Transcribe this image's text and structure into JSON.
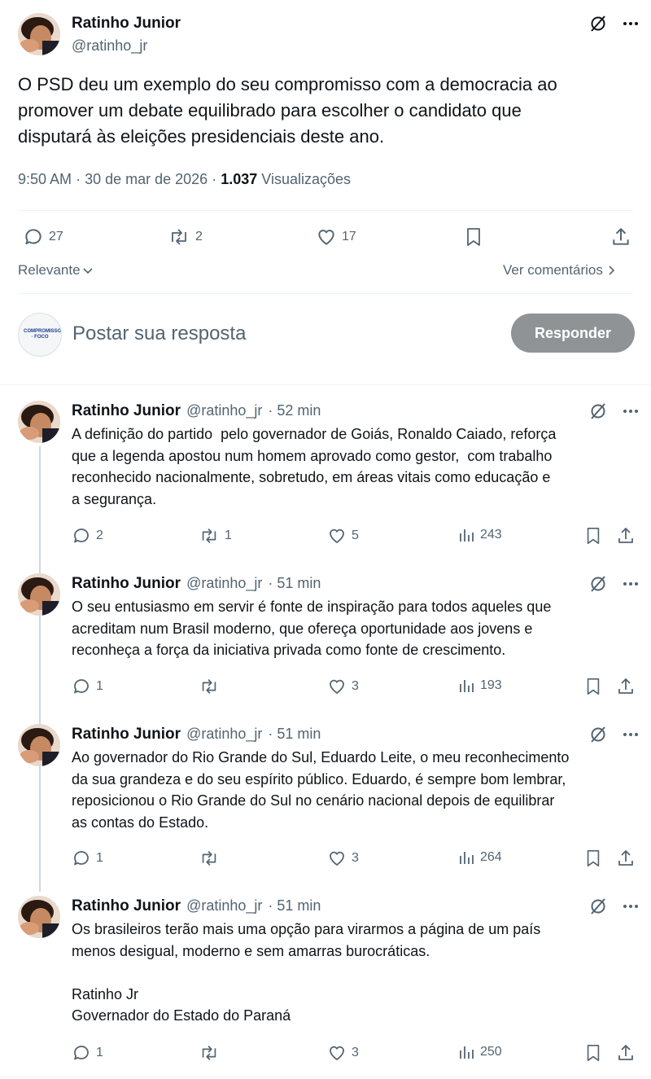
{
  "main_tweet": {
    "author_name": "Ratinho Junior",
    "author_handle": "@ratinho_jr",
    "text": "O PSD deu um exemplo do seu compromisso com a democracia ao\npromover um debate equilibrado para escolher o candidato que\ndisputará às eleições presidenciais deste ano.",
    "time": "9:50 AM",
    "date": "30 de mar de 2026",
    "separator": "·",
    "views_count": "1.037",
    "views_label": "Visualizações",
    "replies": "27",
    "retweets": "2",
    "likes": "17"
  },
  "sort": {
    "label": "Relevante",
    "view_comments": "Ver comentários"
  },
  "compose": {
    "avatar_text": "COMPROMISSO · FOCO",
    "placeholder": "Postar sua resposta",
    "button": "Responder"
  },
  "replies": [
    {
      "name": "Ratinho Junior",
      "handle": "@ratinho_jr",
      "time": "· 52 min",
      "text": "A definição do partido  pelo governador de Goiás, Ronaldo Caiado, reforça\nque a legenda apostou num homem aprovado como gestor,  com trabalho\nreconhecido nacionalmente, sobretudo, em áreas vitais como educação e\na segurança.",
      "replies": "2",
      "retweets": "1",
      "likes": "5",
      "views": "243"
    },
    {
      "name": "Ratinho Junior",
      "handle": "@ratinho_jr",
      "time": "· 51 min",
      "text": "O seu entusiasmo em servir é fonte de inspiração para todos aqueles que\nacreditam num Brasil moderno, que ofereça oportunidade aos jovens e\nreconheça a força da iniciativa privada como fonte de crescimento.",
      "replies": "1",
      "retweets": "",
      "likes": "3",
      "views": "193"
    },
    {
      "name": "Ratinho Junior",
      "handle": "@ratinho_jr",
      "time": "· 51 min",
      "text": "Ao governador do Rio Grande do Sul, Eduardo Leite, o meu reconhecimento\nda sua grandeza e do seu espírito público. Eduardo, é sempre bom lembrar,\nreposicionou o Rio Grande do Sul no cenário nacional depois de equilibrar\nas contas do Estado.",
      "replies": "1",
      "retweets": "",
      "likes": "3",
      "views": "264"
    },
    {
      "name": "Ratinho Junior",
      "handle": "@ratinho_jr",
      "time": "· 51 min",
      "text": "Os brasileiros terão mais uma opção para virarmos a página de um país\nmenos desigual, moderno e sem amarras burocráticas.\n\nRatinho Jr\nGovernador do Estado do Paraná",
      "replies": "1",
      "retweets": "",
      "likes": "3",
      "views": "250"
    }
  ],
  "colors": {
    "text": "#0f1419",
    "muted": "#536471",
    "divider": "#eff3f4",
    "thread": "#cfd9de",
    "button": "#8f9396"
  }
}
